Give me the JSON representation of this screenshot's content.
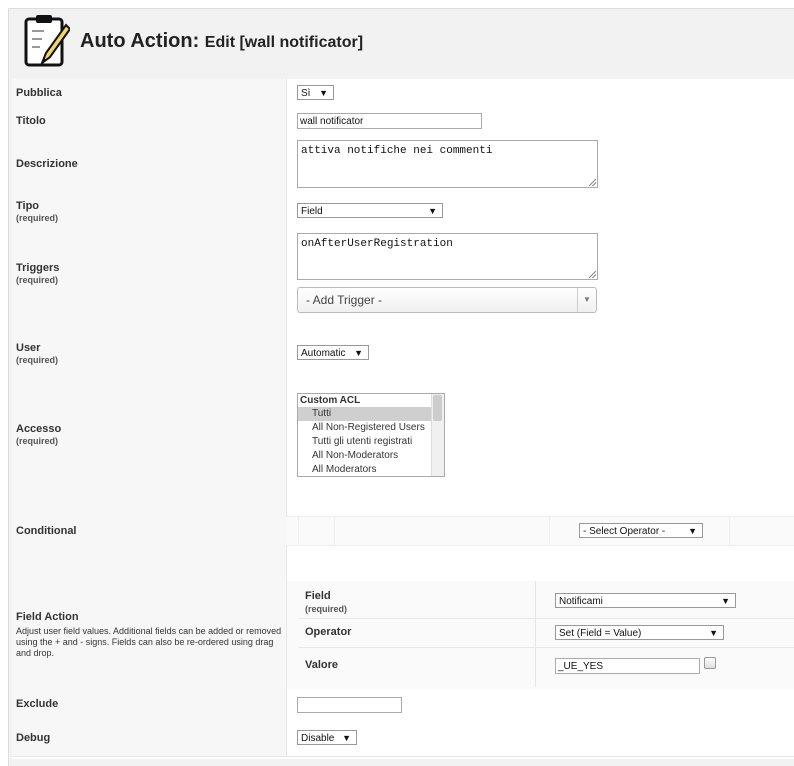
{
  "header": {
    "title_main": "Auto Action:",
    "title_sub": "Edit [wall notificator]",
    "logo_icon": "clipboard-pencil-icon"
  },
  "fields": {
    "pubblica": {
      "label": "Pubblica",
      "value": "Sì"
    },
    "titolo": {
      "label": "Titolo",
      "value": "wall notificator"
    },
    "descrizione": {
      "label": "Descrizione",
      "value": "attiva notifiche nei commenti"
    },
    "tipo": {
      "label": "Tipo",
      "required": "(required)",
      "value": "Field"
    },
    "triggers": {
      "label": "Triggers",
      "required": "(required)",
      "value": "onAfterUserRegistration",
      "add_placeholder": "- Add Trigger -"
    },
    "user": {
      "label": "User",
      "required": "(required)",
      "value": "Automatic"
    },
    "accesso": {
      "label": "Accesso",
      "required": "(required)",
      "group": "Custom ACL",
      "options": [
        "Tutti",
        "All Non-Registered Users",
        "Tutti gli utenti registrati",
        "All Non-Moderators",
        "All Moderators"
      ],
      "selected": "Tutti"
    },
    "conditional": {
      "label": "Conditional",
      "operator_placeholder": "- Select Operator -"
    },
    "field_action": {
      "label": "Field Action",
      "description": "Adjust user field values. Additional fields can be added or removed using the + and - signs. Fields can also be re-ordered using drag and drop.",
      "field_label": "Field",
      "field_required": "(required)",
      "field_value": "Notificami",
      "operator_label": "Operator",
      "operator_value": "Set (Field = Value)",
      "valore_label": "Valore",
      "valore_value": "_UE_YES"
    },
    "exclude": {
      "label": "Exclude",
      "value": ""
    },
    "debug": {
      "label": "Debug",
      "value": "Disable"
    }
  },
  "colors": {
    "label_bg": "#f7f7f7",
    "frame_bg": "#f2f2f2",
    "border": "#e6e6e6"
  }
}
